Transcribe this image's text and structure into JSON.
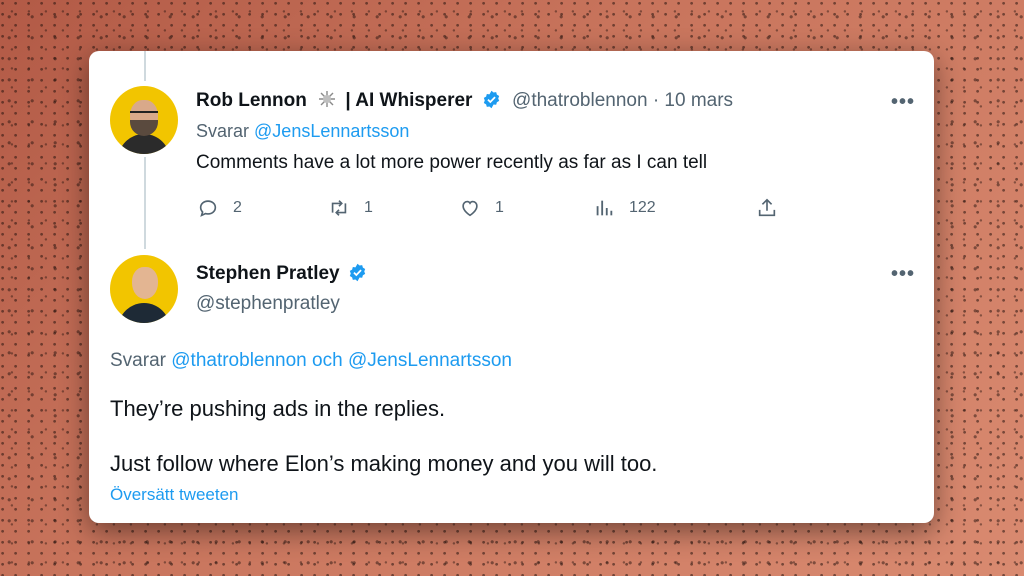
{
  "tweet1": {
    "author_name": "Rob Lennon",
    "author_suffix": "| AI Whisperer",
    "handle": "@thatroblennon",
    "date_sep": "·",
    "date": "10 mars",
    "reply_prefix": "Svarar",
    "reply_to": "@JensLennartsson",
    "text": "Comments have a lot more power recently as far as I can tell",
    "replies": "2",
    "retweets": "1",
    "likes": "1",
    "views": "122",
    "icons": [
      "reply-icon",
      "retweet-icon",
      "like-icon",
      "views-icon",
      "share-icon"
    ]
  },
  "tweet2": {
    "author_name": "Stephen Pratley",
    "handle": "@stephenpratley",
    "reply_prefix": "Svarar",
    "reply_to_1": "@thatroblennon",
    "reply_and": "och",
    "reply_to_2": "@JensLennartsson",
    "text_line1": "They’re pushing ads in the replies.",
    "text_line2": "Just follow where Elon’s making money and you will too.",
    "translate": "Översätt tweeten"
  },
  "more_label": "•••",
  "colors": {
    "accent": "#1d9bf0",
    "text": "#0f1419",
    "muted": "#536471",
    "background": "#c97258"
  }
}
